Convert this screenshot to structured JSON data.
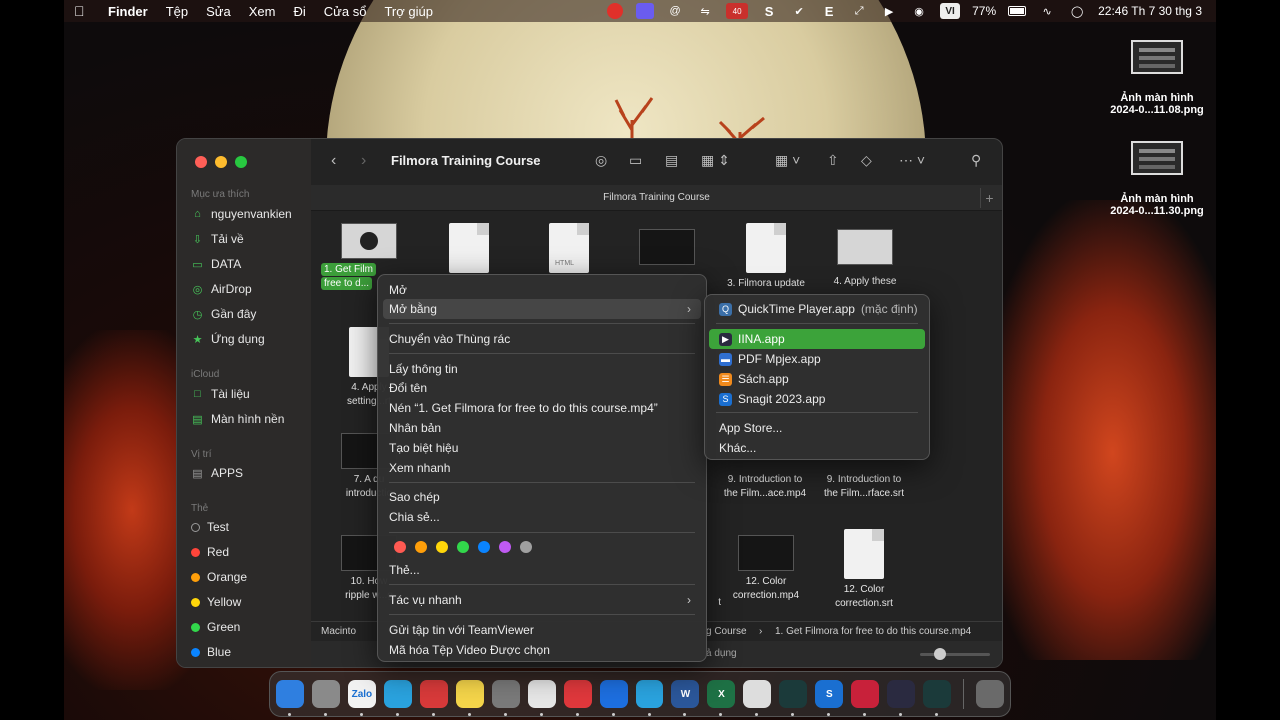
{
  "menubar": {
    "items": [
      "Finder",
      "Tệp",
      "Sửa",
      "Xem",
      "Đi",
      "Cửa sổ",
      "Trợ giúp"
    ],
    "battery": "77%",
    "clock": "22:46 Th 7 30 thg 3",
    "input_source": "VI",
    "notif_badge": "40",
    "status_letters": [
      "S",
      "E"
    ]
  },
  "desktop": {
    "items": [
      {
        "line1": "Ảnh màn hình",
        "line2": "2024-0...11.08.png"
      },
      {
        "line1": "Ảnh màn hình",
        "line2": "2024-0...11.30.png"
      }
    ]
  },
  "finder": {
    "title": "Filmora Training Course",
    "path_title": "Filmora Training Course",
    "sidebar": {
      "favorites_header": "Mục ưa thích",
      "favorites": [
        "nguyenvankien",
        "Tải về",
        "DATA",
        "AirDrop",
        "Gần đây",
        "Ứng dụng"
      ],
      "icloud_header": "iCloud",
      "icloud": [
        "Tài liệu",
        "Màn hình nền"
      ],
      "locations_header": "Vị trí",
      "locations": [
        "APPS"
      ],
      "tags_header": "Thẻ",
      "tags": [
        {
          "name": "Test",
          "color": "transparent"
        },
        {
          "name": "Red",
          "color": "#ff453a"
        },
        {
          "name": "Orange",
          "color": "#ff9f0a"
        },
        {
          "name": "Yellow",
          "color": "#ffd60a"
        },
        {
          "name": "Green",
          "color": "#32d74b"
        },
        {
          "name": "Blue",
          "color": "#0a84ff"
        }
      ]
    },
    "files": {
      "row1": [
        {
          "l1": "1. Get Film",
          "l2": "free to d...",
          "type": "video",
          "selected": true
        },
        {
          "l1": "",
          "l2": "",
          "type": "doc"
        },
        {
          "l1": "",
          "l2": "",
          "type": "html",
          "badge": "HTML"
        },
        {
          "l1": "",
          "l2": "",
          "type": "video"
        },
        {
          "l1": "3. Filmora update",
          "l2": "",
          "type": "doc"
        },
        {
          "l1": "4. Apply these",
          "l2": "",
          "type": "video-light"
        }
      ],
      "row2": [
        {
          "l1": "4. Apply",
          "l2": "setting...rt"
        }
      ],
      "row3": [
        {
          "l1": "7. A qu",
          "l2": "introductio"
        },
        {
          "l1": "9. Introduction to",
          "l2": "the Film...ace.mp4"
        },
        {
          "l1": "9. Introduction to",
          "l2": "the Film...rface.srt"
        }
      ],
      "row4": [
        {
          "l1": "10. How",
          "l2": "ripple w...g"
        },
        {
          "l1": "12. Color",
          "l2": "correction.mp4"
        },
        {
          "l1": "12. Color",
          "l2": "correction.srt"
        },
        {
          "l1": "",
          "l2": "t"
        }
      ]
    },
    "bottom_path": {
      "disk": "Macinto",
      "folder": "g Course",
      "sep": "›",
      "file": "1. Get Filmora for free to do this course.mp4"
    },
    "status": "ả dụng"
  },
  "context_menu": {
    "items": {
      "open": "Mở",
      "open_with": "Mở bằng",
      "trash": "Chuyển vào Thùng rác",
      "info": "Lấy thông tin",
      "rename": "Đổi tên",
      "compress": "Nén “1. Get Filmora for free to do this course.mp4”",
      "duplicate": "Nhân bản",
      "alias": "Tạo biệt hiệu",
      "quicklook": "Xem nhanh",
      "copy": "Sao chép",
      "share": "Chia sẻ...",
      "tags": "Thẻ...",
      "quick_actions": "Tác vụ nhanh",
      "teamviewer": "Gửi tập tin với TeamViewer",
      "encode": "Mã hóa Tệp Video Được chọn"
    },
    "tag_colors": [
      "#ff5a52",
      "#ff9f0a",
      "#ffd60a",
      "#32d74b",
      "#0a84ff",
      "#bf5af2",
      "#a0a0a0"
    ],
    "arrow": "›"
  },
  "open_with_menu": {
    "default_app": "QuickTime Player.app",
    "default_suffix": "(mặc định)",
    "apps": [
      "IINA.app",
      "PDF Mpjex.app",
      "Sách.app",
      "Snagit 2023.app"
    ],
    "app_store": "App Store...",
    "other": "Khác..."
  },
  "dock": {
    "apps": [
      {
        "name": "finder",
        "label": "",
        "color": "#2f7fe0"
      },
      {
        "name": "launchpad",
        "label": "",
        "color": "#8a8a8a"
      },
      {
        "name": "zalo",
        "label": "Zalo",
        "color": "#f2f2f2"
      },
      {
        "name": "telegram",
        "label": "",
        "color": "#2aa3df"
      },
      {
        "name": "teamviewer-remote",
        "label": "",
        "color": "#d93a3a"
      },
      {
        "name": "notes",
        "label": "",
        "color": "#f5d54a"
      },
      {
        "name": "settings",
        "label": "",
        "color": "#7a7a7a"
      },
      {
        "name": "chrome",
        "label": "",
        "color": "#e6e6e6"
      },
      {
        "name": "anydesk",
        "label": "",
        "color": "#e0383c"
      },
      {
        "name": "teamviewer",
        "label": "",
        "color": "#1d6fe0"
      },
      {
        "name": "shield",
        "label": "",
        "color": "#2aa3df"
      },
      {
        "name": "word",
        "label": "W",
        "color": "#2b579a"
      },
      {
        "name": "excel",
        "label": "X",
        "color": "#1e7145"
      },
      {
        "name": "gears",
        "label": "",
        "color": "#dddddd"
      },
      {
        "name": "filmora",
        "label": "",
        "color": "#1b3a3a"
      },
      {
        "name": "snagit",
        "label": "S",
        "color": "#1a6fd1"
      },
      {
        "name": "raspberry",
        "label": "",
        "color": "#c8213a"
      },
      {
        "name": "iina",
        "label": "",
        "color": "#2a2a40"
      },
      {
        "name": "filmora-2",
        "label": "",
        "color": "#1b3a3a"
      }
    ],
    "trash": "trash"
  }
}
